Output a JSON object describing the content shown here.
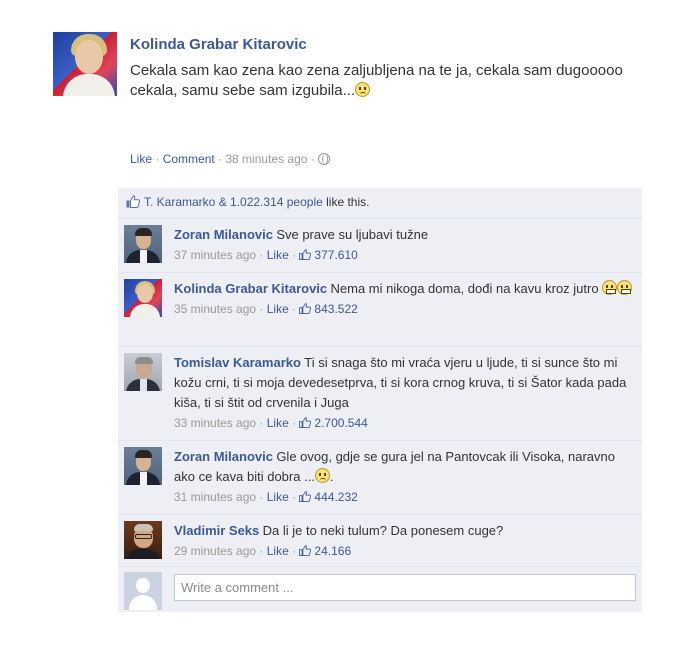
{
  "post": {
    "author": "Kolinda Grabar Kitarovic",
    "text": "Cekala sam kao zena kao zena zaljubljena na te ja, cekala sam dugooooo cekala, samu sebe sam izgubila...",
    "actions": {
      "like": "Like",
      "separator": " · ",
      "comment": "Comment",
      "time": "38 minutes ago",
      "privacy_icon": "globe-icon"
    }
  },
  "likes": {
    "icon": "like-thumb-icon",
    "names": "T. Karamarko & 1.022.314 people",
    "suffix": " like this."
  },
  "comments": [
    {
      "author": "Zoran Milanovic",
      "text": "Sve prave su ljubavi tužne",
      "time": "37 minutes ago",
      "like": "Like",
      "likes_count": "377.610"
    },
    {
      "author": "Kolinda Grabar Kitarovic",
      "text": "Nema mi nikoga doma, dođi na kavu kroz jutro",
      "time": "35 minutes ago",
      "like": "Like",
      "likes_count": "843.522"
    },
    {
      "author": "Tomislav Karamarko",
      "text": "Ti si snaga što mi vraća vjeru u ljude, ti si sunce što mi kožu crni, ti si moja devedesetprva, ti si kora crnog kruva, ti si Šator kada pada kiša, ti si štit od crvenila i Juga",
      "time": "33 minutes ago",
      "like": "Like",
      "likes_count": "2.700.544"
    },
    {
      "author": "Zoran Milanovic",
      "text": "Gle ovog, gdje se gura jel na Pantovcak ili Visoka, naravno ako ce kava biti dobra ...",
      "text_end": ".",
      "time": "31 minutes ago",
      "like": "Like",
      "likes_count": "444.232"
    },
    {
      "author": "Vladimir Seks",
      "text": "Da li je to neki tulum? Da ponesem cuge?",
      "time": "29 minutes ago",
      "like": "Like",
      "likes_count": "24.166"
    }
  ],
  "write_comment": {
    "placeholder": "Write a comment ..."
  },
  "colors": {
    "link": "#3b5998",
    "ufi_background": "#edeff4",
    "meta": "#999999"
  }
}
